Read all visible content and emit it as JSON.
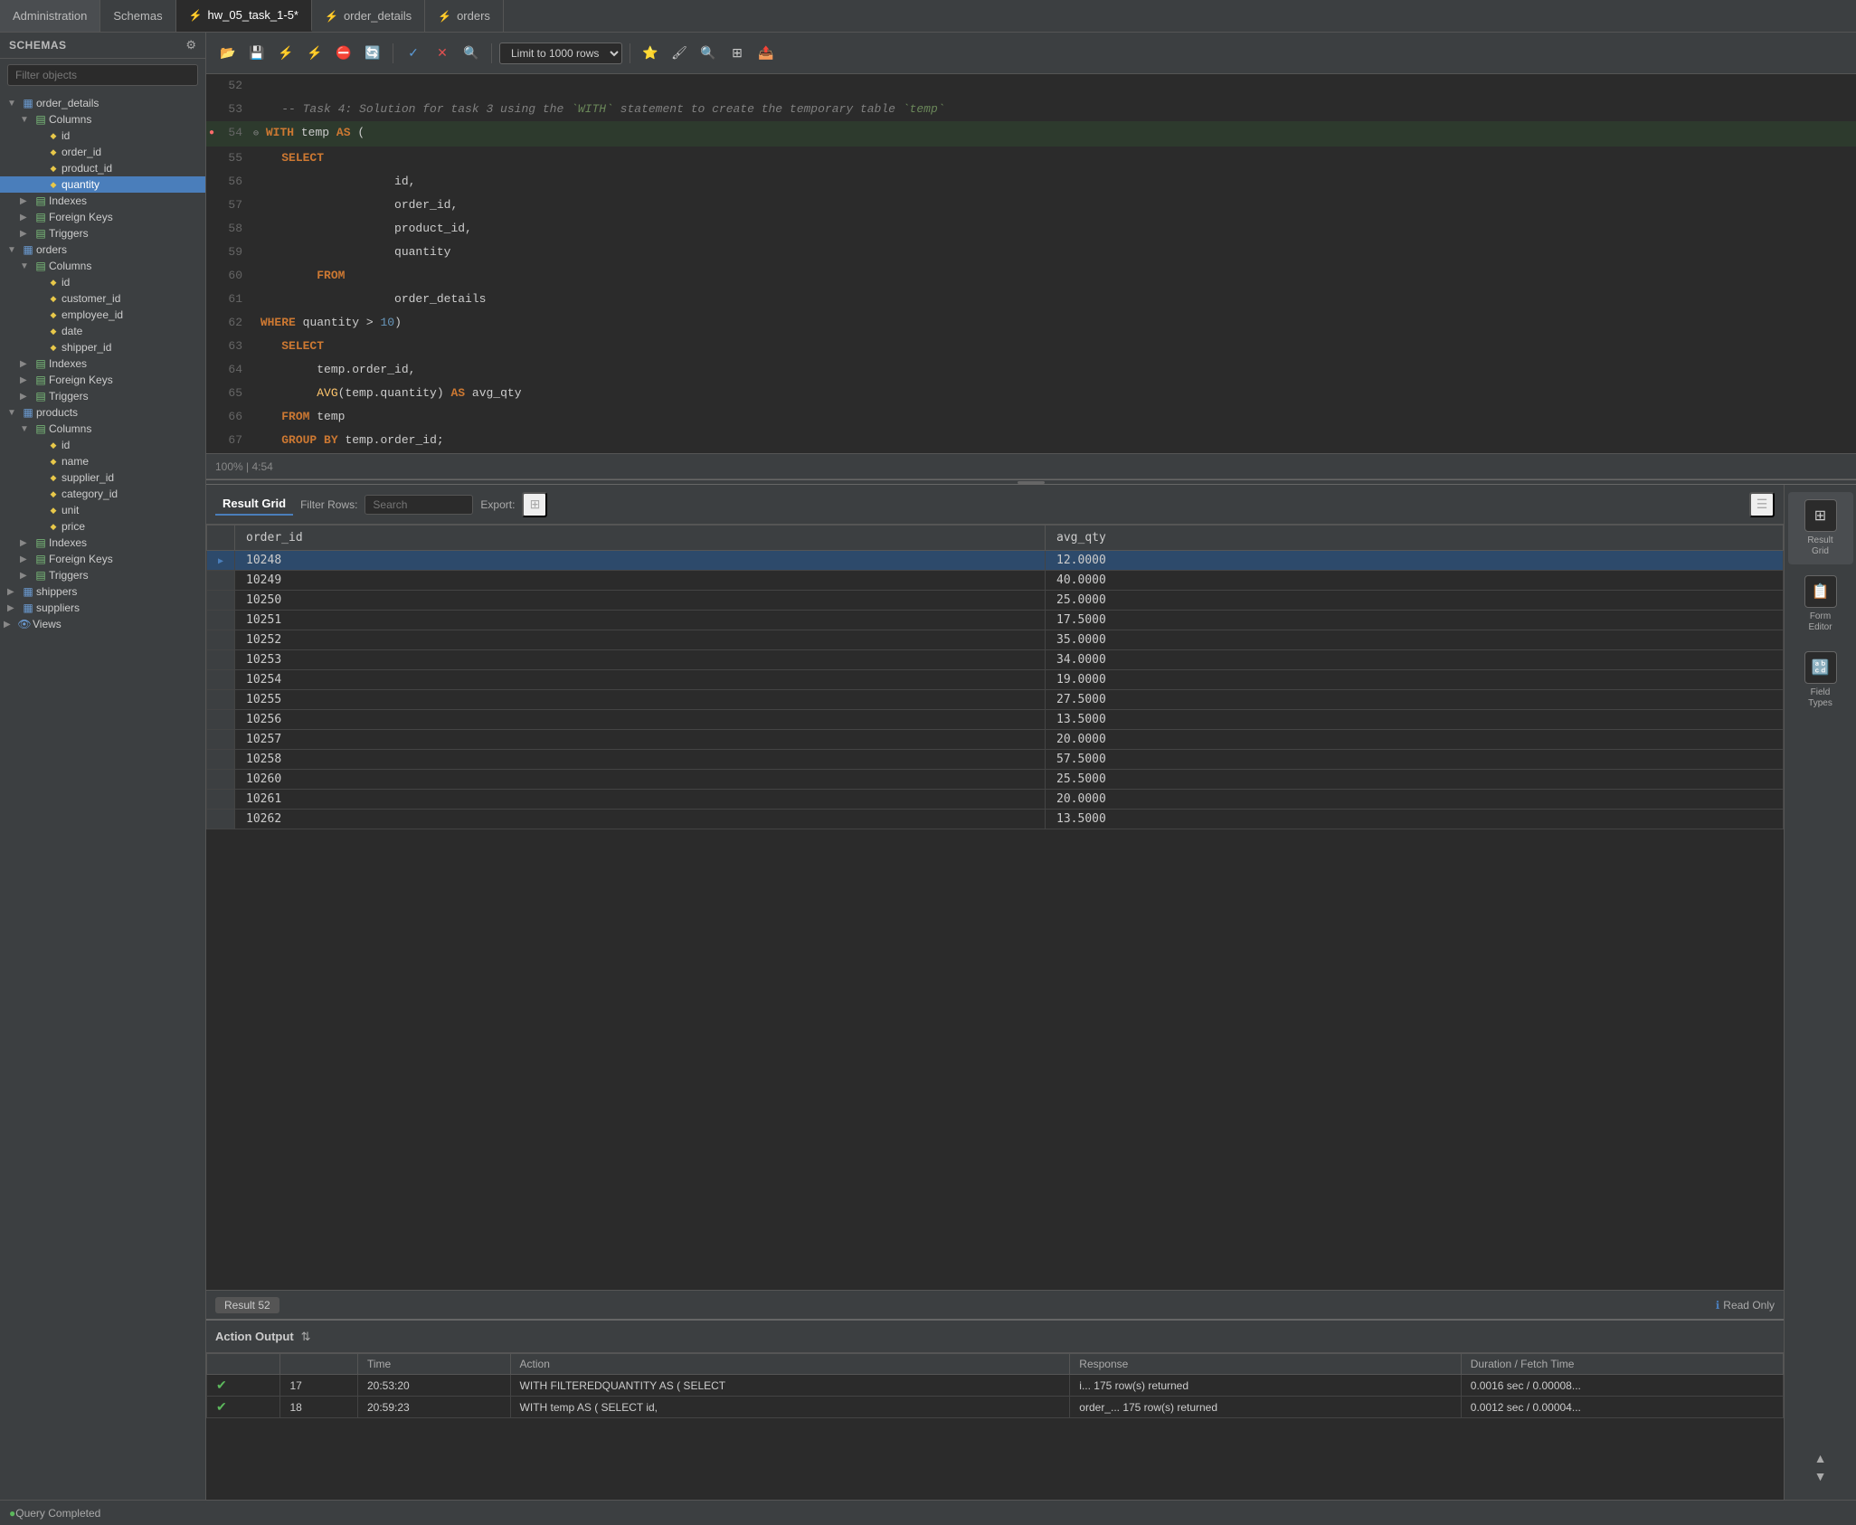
{
  "tabs": [
    {
      "label": "Administration",
      "active": false,
      "icon": ""
    },
    {
      "label": "Schemas",
      "active": false,
      "icon": ""
    },
    {
      "label": "hw_05_task_1-5*",
      "active": true,
      "icon": "bolt"
    },
    {
      "label": "order_details",
      "active": false,
      "icon": "bolt"
    },
    {
      "label": "orders",
      "active": false,
      "icon": "bolt"
    }
  ],
  "sidebar": {
    "title": "SCHEMAS",
    "filter_placeholder": "Filter objects",
    "tree": [
      {
        "id": "order_details",
        "label": "order_details",
        "level": 1,
        "type": "table",
        "expanded": true
      },
      {
        "id": "od_columns",
        "label": "Columns",
        "level": 2,
        "type": "columns",
        "expanded": true
      },
      {
        "id": "od_id",
        "label": "id",
        "level": 3,
        "type": "column"
      },
      {
        "id": "od_order_id",
        "label": "order_id",
        "level": 3,
        "type": "column"
      },
      {
        "id": "od_product_id",
        "label": "product_id",
        "level": 3,
        "type": "column"
      },
      {
        "id": "od_quantity",
        "label": "quantity",
        "level": 3,
        "type": "column",
        "selected": true
      },
      {
        "id": "od_indexes",
        "label": "Indexes",
        "level": 2,
        "type": "indexes"
      },
      {
        "id": "od_fk",
        "label": "Foreign Keys",
        "level": 2,
        "type": "fk"
      },
      {
        "id": "od_triggers",
        "label": "Triggers",
        "level": 2,
        "type": "triggers"
      },
      {
        "id": "orders",
        "label": "orders",
        "level": 1,
        "type": "table",
        "expanded": true
      },
      {
        "id": "or_columns",
        "label": "Columns",
        "level": 2,
        "type": "columns",
        "expanded": true
      },
      {
        "id": "or_id",
        "label": "id",
        "level": 3,
        "type": "column"
      },
      {
        "id": "or_customer_id",
        "label": "customer_id",
        "level": 3,
        "type": "column"
      },
      {
        "id": "or_employee_id",
        "label": "employee_id",
        "level": 3,
        "type": "column"
      },
      {
        "id": "or_date",
        "label": "date",
        "level": 3,
        "type": "column"
      },
      {
        "id": "or_shipper_id",
        "label": "shipper_id",
        "level": 3,
        "type": "column"
      },
      {
        "id": "or_indexes",
        "label": "Indexes",
        "level": 2,
        "type": "indexes"
      },
      {
        "id": "or_fk",
        "label": "Foreign Keys",
        "level": 2,
        "type": "fk"
      },
      {
        "id": "or_triggers",
        "label": "Triggers",
        "level": 2,
        "type": "triggers"
      },
      {
        "id": "products",
        "label": "products",
        "level": 1,
        "type": "table",
        "expanded": true
      },
      {
        "id": "pr_columns",
        "label": "Columns",
        "level": 2,
        "type": "columns",
        "expanded": true
      },
      {
        "id": "pr_id",
        "label": "id",
        "level": 3,
        "type": "column"
      },
      {
        "id": "pr_name",
        "label": "name",
        "level": 3,
        "type": "column"
      },
      {
        "id": "pr_supplier_id",
        "label": "supplier_id",
        "level": 3,
        "type": "column"
      },
      {
        "id": "pr_category_id",
        "label": "category_id",
        "level": 3,
        "type": "column"
      },
      {
        "id": "pr_unit",
        "label": "unit",
        "level": 3,
        "type": "column"
      },
      {
        "id": "pr_price",
        "label": "price",
        "level": 3,
        "type": "column"
      },
      {
        "id": "pr_indexes",
        "label": "Indexes",
        "level": 2,
        "type": "indexes"
      },
      {
        "id": "pr_fk",
        "label": "Foreign Keys",
        "level": 2,
        "type": "fk"
      },
      {
        "id": "pr_triggers",
        "label": "Triggers",
        "level": 2,
        "type": "triggers"
      },
      {
        "id": "shippers",
        "label": "shippers",
        "level": 1,
        "type": "table"
      },
      {
        "id": "suppliers",
        "label": "suppliers",
        "level": 1,
        "type": "table"
      },
      {
        "id": "views",
        "label": "Views",
        "level": 0,
        "type": "views"
      }
    ]
  },
  "toolbar": {
    "limit_label": "Limit to 1000 rows"
  },
  "editor": {
    "lines": [
      {
        "num": 52,
        "content": ""
      },
      {
        "num": 53,
        "content": "    -- Task 4: Solution for task 3 using the `WITH` statement to create the temporary table `temp`"
      },
      {
        "num": 54,
        "content": " WITH temp AS (",
        "has_marker": true,
        "marker_type": "breakpoint_collapse"
      },
      {
        "num": 55,
        "content": "     SELECT"
      },
      {
        "num": 56,
        "content": "                     id,"
      },
      {
        "num": 57,
        "content": "                     order_id,"
      },
      {
        "num": 58,
        "content": "                     product_id,"
      },
      {
        "num": 59,
        "content": "                     quantity"
      },
      {
        "num": 60,
        "content": "          FROM"
      },
      {
        "num": 61,
        "content": "                     order_details"
      },
      {
        "num": 62,
        "content": " WHERE quantity > 10)"
      },
      {
        "num": 63,
        "content": "     SELECT"
      },
      {
        "num": 64,
        "content": "          temp.order_id,"
      },
      {
        "num": 65,
        "content": "          AVG(temp.quantity) AS avg_qty"
      },
      {
        "num": 66,
        "content": "     FROM temp"
      },
      {
        "num": 67,
        "content": "     GROUP BY temp.order_id;"
      }
    ],
    "cursor": "100% | 4:54"
  },
  "result_grid": {
    "title": "Result Grid",
    "filter_placeholder": "Search",
    "export_label": "Export:",
    "columns": [
      "order_id",
      "avg_qty"
    ],
    "rows": [
      {
        "order_id": "10248",
        "avg_qty": "12.0000",
        "first": true
      },
      {
        "order_id": "10249",
        "avg_qty": "40.0000"
      },
      {
        "order_id": "10250",
        "avg_qty": "25.0000"
      },
      {
        "order_id": "10251",
        "avg_qty": "17.5000"
      },
      {
        "order_id": "10252",
        "avg_qty": "35.0000"
      },
      {
        "order_id": "10253",
        "avg_qty": "34.0000"
      },
      {
        "order_id": "10254",
        "avg_qty": "19.0000"
      },
      {
        "order_id": "10255",
        "avg_qty": "27.5000"
      },
      {
        "order_id": "10256",
        "avg_qty": "13.5000"
      },
      {
        "order_id": "10257",
        "avg_qty": "20.0000"
      },
      {
        "order_id": "10258",
        "avg_qty": "57.5000"
      },
      {
        "order_id": "10260",
        "avg_qty": "25.5000"
      },
      {
        "order_id": "10261",
        "avg_qty": "20.0000"
      },
      {
        "order_id": "10262",
        "avg_qty": "13.5000"
      }
    ],
    "footer": {
      "result_label": "Result 52",
      "readonly_label": "Read Only"
    }
  },
  "side_icons": [
    {
      "label": "Result\nGrid",
      "icon": "⊞",
      "active": true
    },
    {
      "label": "Form\nEditor",
      "icon": "📝"
    },
    {
      "label": "Field\nTypes",
      "icon": "🔤"
    },
    {
      "label": "",
      "icon": "⬆",
      "scroll": true
    },
    {
      "label": "",
      "icon": "⬇",
      "scroll": true
    }
  ],
  "action_output": {
    "title": "Action Output",
    "columns": [
      "",
      "Time",
      "Action",
      "Response",
      "Duration / Fetch Time"
    ],
    "rows": [
      {
        "num": "17",
        "time": "20:53:20",
        "action": "WITH FILTEREDQUANTITY AS ( SELECT",
        "response": "i...  175 row(s) returned",
        "duration": "0.0016 sec / 0.00008..."
      },
      {
        "num": "18",
        "time": "20:59:23",
        "action": "WITH temp AS ( SELECT    id,",
        "response": "order_...  175 row(s) returned",
        "duration": "0.0012 sec / 0.00004..."
      }
    ]
  },
  "bottom_status": {
    "text": "Query Completed"
  }
}
